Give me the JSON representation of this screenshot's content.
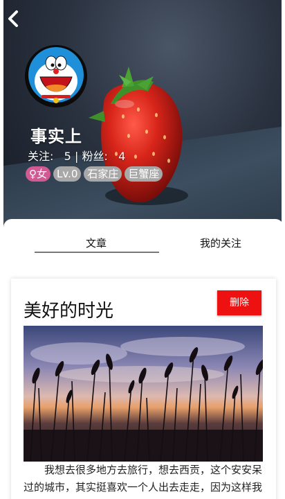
{
  "profile": {
    "username": "事实上",
    "following_label": "关注:",
    "following_count": "5",
    "separator": "|",
    "followers_label": "粉丝:",
    "followers_count": "4",
    "tags": [
      "♀女",
      "Lv.0",
      "石家庄",
      "巨蟹座"
    ]
  },
  "tabs": {
    "articles": "文章",
    "my_following": "我的关注",
    "active": "articles"
  },
  "article": {
    "title": "美好的时光",
    "delete_label": "删除",
    "body": "我想去很多地方去旅行，想去西贡，这个安安呆过的城市，其实挺喜欢一个人出去走走，因为这样我会有安全感，我不太想跟别人一同时别人也不够"
  },
  "colors": {
    "gender_tag": "#d25a93",
    "delete_button": "#ee1111",
    "tab_underline": "#777777"
  }
}
